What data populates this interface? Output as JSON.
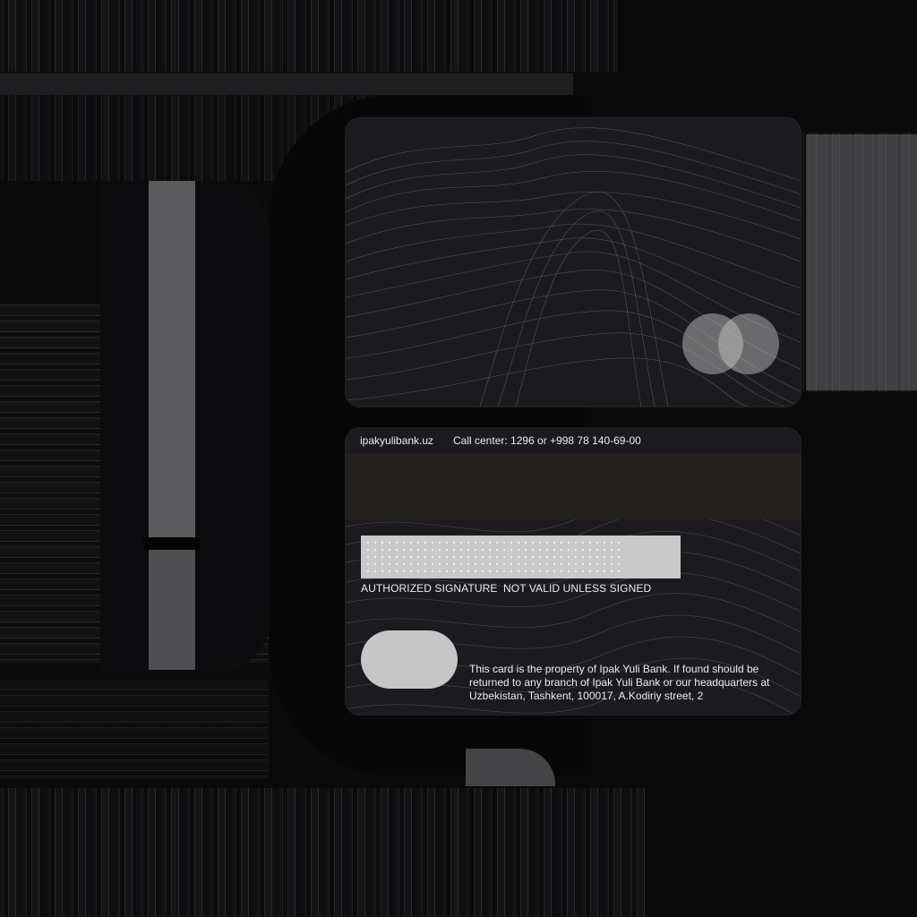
{
  "card_back": {
    "website": "ipakyulibank.uz",
    "call_center": "Call center: 1296 or +998 78 140-69-00",
    "signature_label": "AUTHORIZED SIGNATURE",
    "not_valid_label": "NOT VALID UNLESS SIGNED",
    "property_notice": "This card is the property of Ipak Yuli Bank. If found should be returned to any branch of Ipak Yuli Bank or our headquarters at Uzbekistan, Tashkent, 100017, A.Kodiriy street, 2"
  },
  "card_front": {
    "logo_icon": "two-overlapping-circles-logo-icon"
  },
  "colors": {
    "background": "#0a0a0b",
    "card": "#1b1b1f",
    "magnetic_stripe": "#252020",
    "signature_panel": "#c9c9c9",
    "text": "#ececec"
  }
}
